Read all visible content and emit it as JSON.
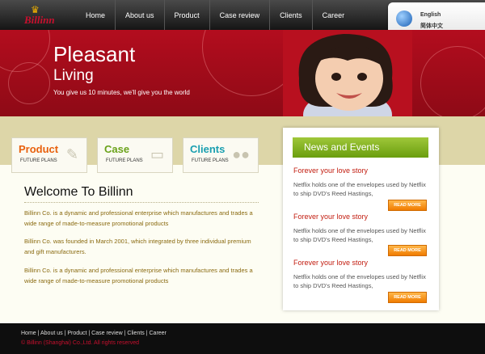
{
  "header": {
    "logo_text": "Billinn",
    "nav": [
      "Home",
      "About us",
      "Product",
      "Case review",
      "Clients",
      "Career"
    ],
    "lang_en": "English",
    "lang_cn": "简体中文"
  },
  "banner": {
    "title1": "Pleasant",
    "title2": "Living",
    "subtitle": "You give us 10 minutes, we'll give you the world"
  },
  "cards": [
    {
      "title": "Product",
      "subtitle": "FUTURE PLANS",
      "color": "#e8600c"
    },
    {
      "title": "Case",
      "subtitle": "FUTURE PLANS",
      "color": "#6aa21a"
    },
    {
      "title": "Clients",
      "subtitle": "FUTURE PLANS",
      "color": "#1a9fb0"
    }
  ],
  "welcome": {
    "title": "Welcome To Billinn",
    "paragraphs": [
      "Billinn Co. is a dynamic and professional enterprise which manufactures and trades a wide range of  made-to-measure promotional products",
      "Billinn Co. was founded in March 2001, which integrated by three individual premium and gift manufacturers.",
      "Billinn Co. is a dynamic and professional enterprise which manufactures and trades a wide range of  made-to-measure promotional products"
    ]
  },
  "news": {
    "title": "News and Events",
    "items": [
      {
        "title": "Forever your love story",
        "text": "Netflix holds one of the envelopes used by Netflix to ship DVD's Reed Hastings,",
        "more": "READ MORE"
      },
      {
        "title": "Forever your love story",
        "text": "Netflix holds one of the envelopes used by Netflix to ship DVD's Reed Hastings,",
        "more": "READ MORE"
      },
      {
        "title": "Forever your love story",
        "text": "Netflix holds one of the envelopes used by Netflix to ship DVD's Reed Hastings,",
        "more": "READ MORE"
      }
    ]
  },
  "footer": {
    "links": "Home | About us | Product | Case review | Clients | Career",
    "copyright": "© Billinn (Shanghai) Co.,Ltd. All rights reserved"
  },
  "colors": {
    "brand_red": "#b30d1e",
    "news_green": "#7cb01a",
    "button_orange": "#f08c10"
  }
}
